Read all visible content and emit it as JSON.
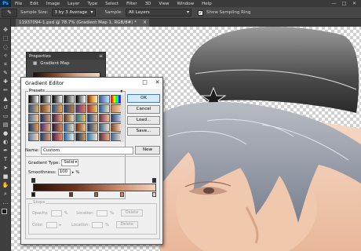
{
  "app": {
    "logo": "Ps"
  },
  "menu": [
    "File",
    "Edit",
    "Image",
    "Layer",
    "Type",
    "Select",
    "Filter",
    "3D",
    "View",
    "Window",
    "Help"
  ],
  "window_controls": {
    "minimize": "—",
    "restore": "□",
    "close": "✕"
  },
  "options_bar": {
    "sample_size_label": "Sample Size:",
    "sample_size_value": "3 by 3 Average",
    "sample_label": "Sample:",
    "sample_value": "All Layers",
    "show_ring_label": "Show Sampling Ring",
    "show_ring_checked": true
  },
  "document": {
    "tab_title": "11937094-1.psd @ 78.7% (Gradient Map 1, RGB/8#) *"
  },
  "properties_panel": {
    "title": "Properties",
    "row_label": "Gradient Map"
  },
  "gradient_editor": {
    "title": "Gradient Editor",
    "presets_label": "Presets",
    "buttons": {
      "ok": "OK",
      "cancel": "Cancel",
      "load": "Load...",
      "save": "Save...",
      "new": "New"
    },
    "name_label": "Name:",
    "name_value": "Custom",
    "gradient_type_label": "Gradient Type:",
    "gradient_type_value": "Solid",
    "smoothness_label": "Smoothness:",
    "smoothness_value": "100",
    "smoothness_unit": "%",
    "stops_label": "Stops",
    "opacity_label": "Opacity:",
    "location_label": "Location:",
    "color_label": "Color:",
    "delete_label": "Delete",
    "percent": "%",
    "preset_swatches": [
      "linear-gradient(90deg,#000,#fff)",
      "linear-gradient(90deg,#000,#fff0)",
      "linear-gradient(90deg,#000,#fff)",
      "linear-gradient(90deg,#111,#ddd)",
      "linear-gradient(90deg,#000,#888,#fff)",
      "linear-gradient(90deg,#7a2a00,#e0a050,#fff3b0)",
      "linear-gradient(90deg,#3a5a9a,#cfe4ff)",
      "linear-gradient(90deg,#ff0000,#ff8000,#ffff00,#00ff00,#00ffff,#0000ff,#ff00ff)",
      "linear-gradient(90deg,#2b4f7a,#e0b070)",
      "linear-gradient(90deg,#6b3a1a,#e8b58a)",
      "linear-gradient(90deg,#274c8a,#f2a650)",
      "linear-gradient(90deg,#1f3c70,#c08040)",
      "linear-gradient(90deg,#503070,#e08060)",
      "linear-gradient(90deg,#a03030,#f0d070)",
      "linear-gradient(90deg,#2060a0,#f0e0c0)",
      "linear-gradient(90deg,#c08050,#f0d0b0)",
      "linear-gradient(90deg,#4a6fa5,#f7c98b)",
      "linear-gradient(90deg,#1e2f5a,#d6a37a)",
      "linear-gradient(90deg,#3b1f3f,#f0a080)",
      "linear-gradient(90deg,#5a3a20,#f5e0c0)",
      "linear-gradient(90deg,#2a6a8a,#e8c070)",
      "linear-gradient(90deg,#1a4070,#eec090)",
      "linear-gradient(90deg,#703040,#f0c0a0)",
      "linear-gradient(90deg,#304060,#c0d0f0)",
      "linear-gradient(90deg,#0a3d6b,#f3a05a)",
      "linear-gradient(90deg,#452a60,#f0b080)",
      "linear-gradient(90deg,#1e1e3a,#e08860)",
      "linear-gradient(90deg,#2e5a88,#f8e0b8)",
      "linear-gradient(90deg,#6a2a1a,#f0c890)",
      "linear-gradient(90deg,#223a66,#d8b080)",
      "linear-gradient(90deg,#3a5a80,#f0e8d8)",
      "linear-gradient(90deg,#7a4a2a,#f8d8c0)",
      "linear-gradient(90deg,#5b7fb0,#fbd9a8)",
      "linear-gradient(90deg,#2a3a70,#e0a070)",
      "linear-gradient(90deg,#4a2050,#e88a70)",
      "linear-gradient(90deg,#2a6a9a,#f0f0f0)",
      "linear-gradient(90deg,#1a2a4a,#c8a070)",
      "linear-gradient(90deg,#3a7ab0,#f8e8d0)",
      "linear-gradient(90deg,#602a3a,#e8b090)",
      "linear-gradient(90deg,#4a6a90,#e8d8c8)"
    ]
  },
  "colors": {
    "foreground": "#1a1a1a",
    "background": "#ffffff",
    "gradient_start": "#2a120a",
    "gradient_end": "#f3d1bd"
  }
}
